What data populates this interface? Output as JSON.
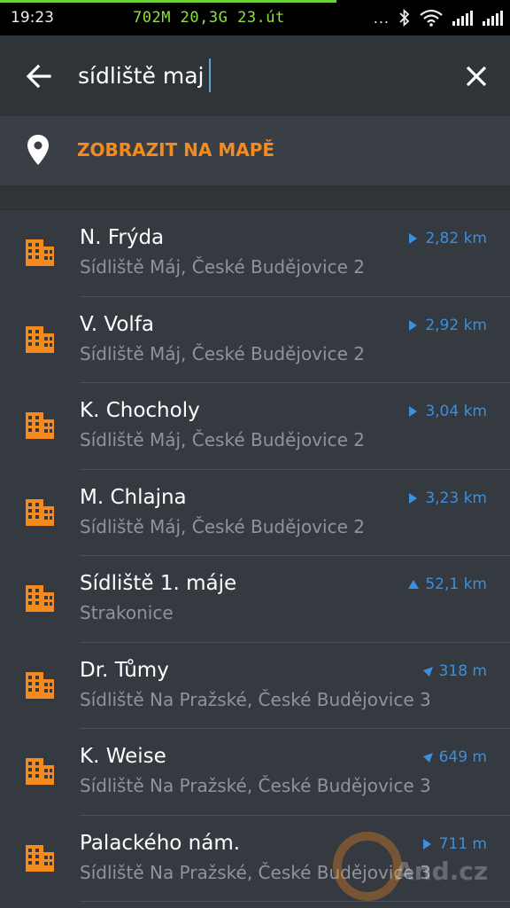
{
  "status_bar": {
    "time": "19:23",
    "mem_info": "702M  20,3G 23.út",
    "dots": "...",
    "icons": [
      "bluetooth-icon",
      "wifi-icon",
      "signal-icon",
      "signal-icon"
    ]
  },
  "search": {
    "query": "sídliště maj",
    "back_icon": "arrow-left-icon",
    "close_icon": "close-icon"
  },
  "map_action": {
    "label": "ZOBRAZIT NA MAPĚ",
    "icon": "map-pin-icon"
  },
  "results": [
    {
      "title": "N. Frýda",
      "subtitle": "Sídliště Máj, České Budějovice 2",
      "distance": "2,82 km",
      "direction": "east"
    },
    {
      "title": "V. Volfa",
      "subtitle": "Sídliště Máj, České Budějovice 2",
      "distance": "2,92 km",
      "direction": "east"
    },
    {
      "title": "K. Chocholy",
      "subtitle": "Sídliště Máj, České Budějovice 2",
      "distance": "3,04 km",
      "direction": "east"
    },
    {
      "title": "M. Chlajna",
      "subtitle": "Sídliště Máj, České Budějovice 2",
      "distance": "3,23 km",
      "direction": "east"
    },
    {
      "title": "Sídliště 1. máje",
      "subtitle": "Strakonice",
      "distance": "52,1 km",
      "direction": "north"
    },
    {
      "title": "Dr. Tůmy",
      "subtitle": "Sídliště Na Pražské, České Budějovice 3",
      "distance": "318 m",
      "direction": "southwest"
    },
    {
      "title": "K. Weise",
      "subtitle": "Sídliště Na Pražské, České Budějovice 3",
      "distance": "649 m",
      "direction": "southwest"
    },
    {
      "title": "Palackého nám.",
      "subtitle": "Sídliště Na Pražské, České Budějovice 3",
      "distance": "711 m",
      "direction": "east"
    }
  ],
  "colors": {
    "accent_orange": "#f58a1f",
    "distance_blue": "#3b8fe0",
    "background": "#343a40"
  },
  "watermark": "And.cz"
}
